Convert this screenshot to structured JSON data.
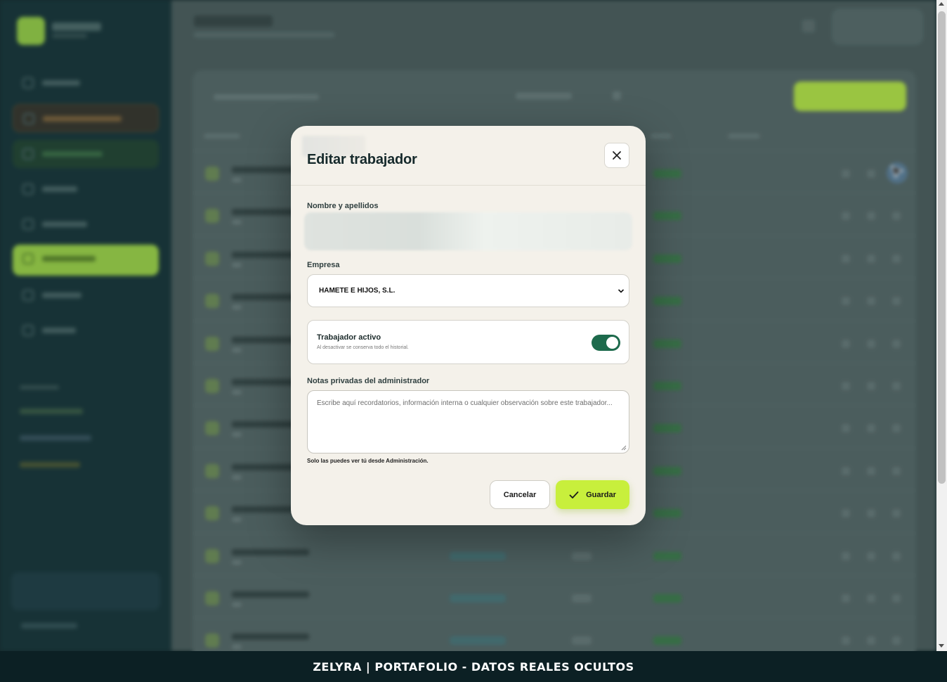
{
  "modal": {
    "title": "Editar trabajador",
    "close_icon": "close-icon",
    "name_label": "Nombre y apellidos",
    "company_label": "Empresa",
    "company_value": "HAMETE E HIJOS, S.L.",
    "active_title": "Trabajador activo",
    "active_subtitle": "Al desactivar se conserva todo el historial.",
    "active_on": true,
    "notes_label": "Notas privadas del administrador",
    "notes_placeholder": "Escribe aquí recordatorios, información interna o cualquier observación sobre este trabajador...",
    "notes_hint": "Solo las puedes ver tú desde Administración.",
    "cancel_label": "Cancelar",
    "save_label": "Guardar",
    "save_icon": "check-icon"
  },
  "banner": {
    "text": "ZELYRA | PORTAFOLIO - DATOS REALES OCULTOS"
  },
  "colors": {
    "accent": "#c8ef3c",
    "toggle": "#1d6a4c",
    "sidebar": "#0e2a2e",
    "modal_bg": "#f4f1ea"
  }
}
